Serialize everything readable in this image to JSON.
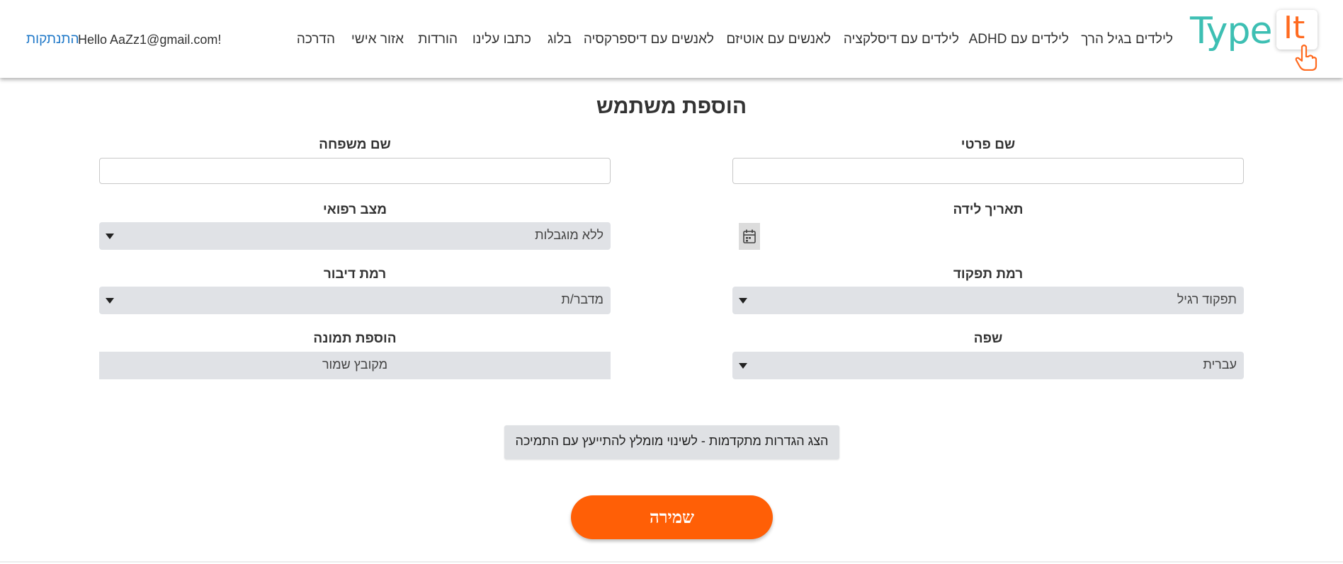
{
  "logo": {
    "type_text": "Type",
    "it_text": "It"
  },
  "nav": {
    "items": [
      "לילדים בגיל הרך",
      "לילדים עם ADHD",
      "לילדים עם דיסלקציה",
      "לאנשים עם אוטיזם",
      "לאנשים עם דיספרקסיה",
      "בלוג",
      "כתבו עלינו",
      "הורדות",
      "אזור אישי",
      "הדרכה"
    ],
    "greeting": "Hello AaZz1@gmail.com!",
    "logout": "התנתקות"
  },
  "form": {
    "title": "הוספת משתמש",
    "first_name": {
      "label": "שם פרטי",
      "value": ""
    },
    "last_name": {
      "label": "שם משפחה",
      "value": ""
    },
    "birth_date": {
      "label": "תאריך לידה"
    },
    "medical": {
      "label": "מצב רפואי",
      "value": "ללא מוגבלות"
    },
    "function_level": {
      "label": "רמת תפקוד",
      "value": "תפקוד רגיל"
    },
    "speech_level": {
      "label": "רמת דיבור",
      "value": "מדבר/ת"
    },
    "language": {
      "label": "שפה",
      "value": "עברית"
    },
    "photo": {
      "label": "הוספת תמונה",
      "value": "מקובץ שמור"
    },
    "advanced_button": "הצג הגדרות מתקדמות - לשינוי מומלץ להתייעץ עם התמיכה",
    "save_button": "שמירה"
  },
  "colors": {
    "accent": "#ff5f06",
    "logo_teal": "#3dbfb3",
    "link": "#1f78c8",
    "field_bg": "#e0e2e6"
  },
  "icons": {
    "calendar": "calendar-icon",
    "dropdown": "chevron-down-icon",
    "hand": "hand-pointer-icon"
  }
}
